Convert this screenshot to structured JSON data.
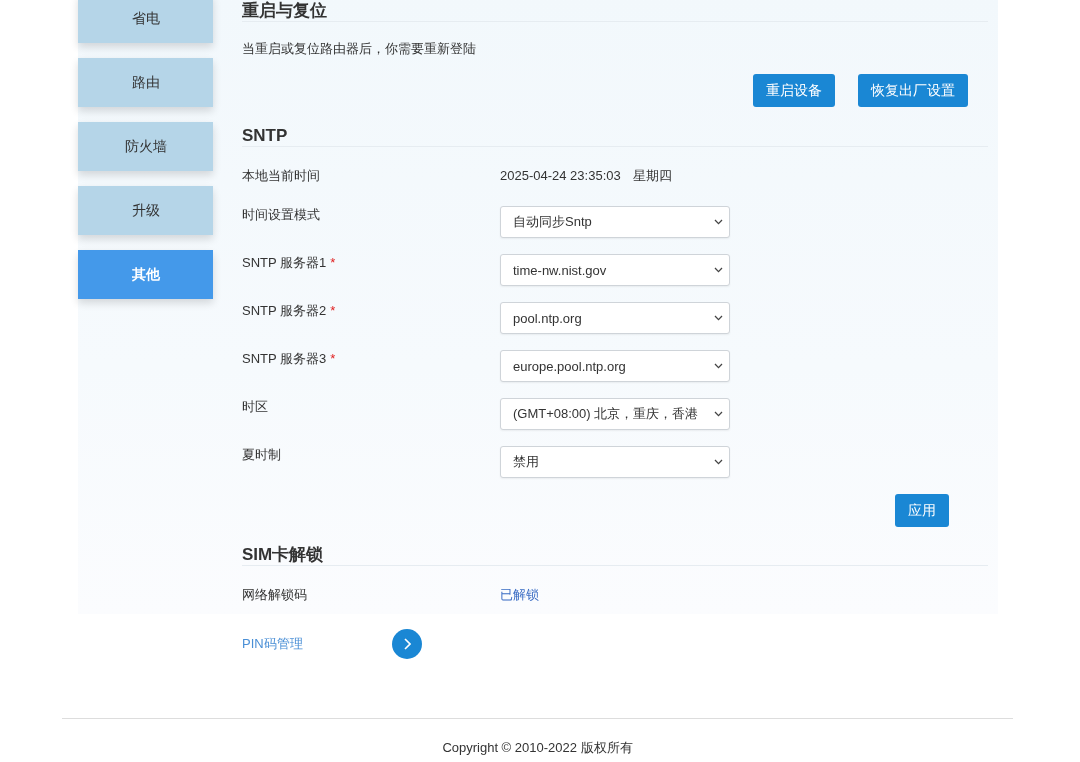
{
  "sidebar": {
    "items": [
      {
        "label": "省电",
        "selected": false
      },
      {
        "label": "路由",
        "selected": false
      },
      {
        "label": "防火墙",
        "selected": false
      },
      {
        "label": "升级",
        "selected": false
      },
      {
        "label": "其他",
        "selected": true
      }
    ]
  },
  "reset_section": {
    "title": "重启与复位",
    "description": "当重启或复位路由器后，你需要重新登陆",
    "buttons": [
      "重启设备",
      "恢复出厂设置"
    ]
  },
  "sntp_section": {
    "title": "SNTP",
    "fields": [
      {
        "kind": "text",
        "label": "本地当前时间",
        "value": "2025-04-24 23:35:03",
        "weekday": "星期四"
      },
      {
        "kind": "select",
        "label": "时间设置模式",
        "value": "自动同步Sntp"
      },
      {
        "kind": "select",
        "label": "SNTP 服务器1",
        "required_mark": "*",
        "value": "time-nw.nist.gov"
      },
      {
        "kind": "select",
        "label": "SNTP 服务器2",
        "required_mark": "*",
        "value": "pool.ntp.org"
      },
      {
        "kind": "select",
        "label": "SNTP 服务器3",
        "required_mark": "*",
        "value": "europe.pool.ntp.org"
      },
      {
        "kind": "select",
        "label": "时区",
        "value": "(GMT+08:00) 北京，重庆，香港"
      },
      {
        "kind": "select",
        "label": "夏时制",
        "value": "禁用"
      }
    ],
    "apply_button": "应用"
  },
  "sim_section": {
    "title": "SIM卡解锁",
    "fields": [
      {
        "kind": "status",
        "label": "网络解锁码",
        "value": "已解锁"
      }
    ]
  },
  "pin_row": {
    "label": "PIN码管理"
  },
  "footer": {
    "copyright": "Copyright © 2010-2022 版权所有"
  }
}
